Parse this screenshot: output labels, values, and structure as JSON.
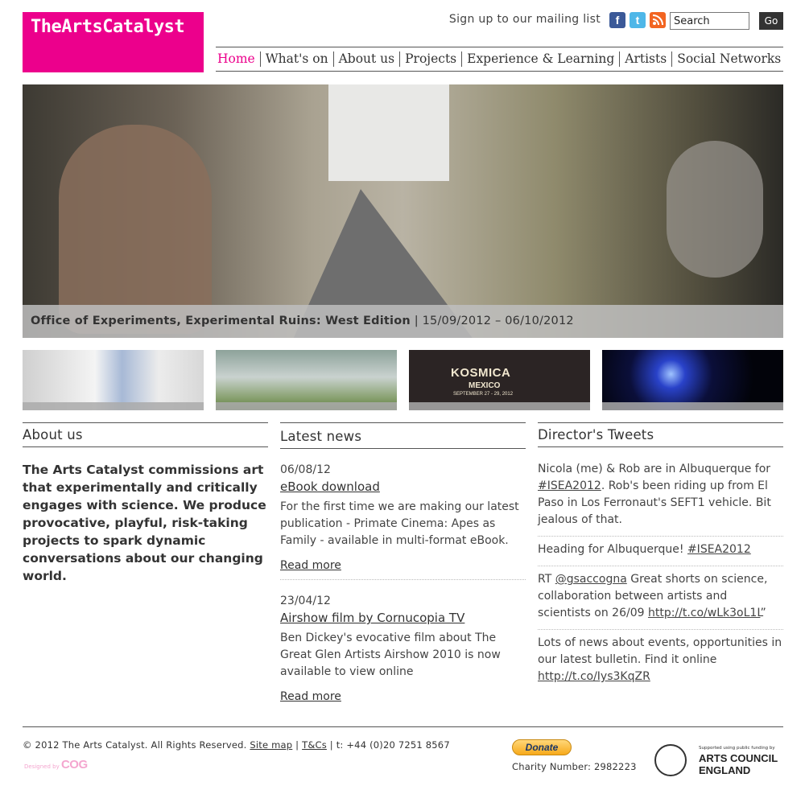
{
  "brand": {
    "logo_text": "TheArtsCatalyst",
    "accent_color": "#ec008c"
  },
  "header": {
    "signup_label": "Sign up to our mailing list",
    "social": {
      "facebook": "f",
      "twitter": "t",
      "rss": "rss"
    },
    "search": {
      "placeholder": "Search",
      "value": "Search",
      "go_label": "Go"
    }
  },
  "nav": {
    "items": [
      "Home",
      "What's on",
      "About us",
      "Projects",
      "Experience & Learning",
      "Artists",
      "Social Networks"
    ],
    "active": "Home"
  },
  "hero": {
    "title": "Office of Experiments, Experimental Ruins: West Edition",
    "dates": " | 15/09/2012 – 06/10/2012"
  },
  "thumbs": {
    "kosmica": {
      "title": "KOSMICA",
      "sub": "MEXICO",
      "dates": "SEPTEMBER 27 - 29, 2012"
    }
  },
  "about": {
    "heading": "About us",
    "text": "The Arts Catalyst commissions art that experimentally and critically engages with science. We produce provocative, playful, risk-taking projects to spark dynamic conversations about our changing world."
  },
  "news": {
    "heading": "Latest news",
    "items": [
      {
        "date": "06/08/12",
        "title": "eBook download",
        "excerpt": "For the first time we are making our latest publication - Primate Cinema: Apes as Family - available in multi-format eBook.",
        "more": "Read more"
      },
      {
        "date": "23/04/12",
        "title": "Airshow film by Cornucopia TV",
        "excerpt": "Ben Dickey's evocative film about The Great Glen Artists Airshow 2010 is now available to view online",
        "more": "Read more"
      }
    ]
  },
  "tweets": {
    "heading": "Director's Tweets",
    "items": [
      {
        "a": "Nicola (me) & Rob are in Albuquerque for ",
        "link": "#ISEA2012",
        "b": ". Rob's been riding up from El Paso in Los Ferronaut's SEFT1 vehicle. Bit jealous of that."
      },
      {
        "a": "Heading for Albuquerque! ",
        "link": "#ISEA2012",
        "b": ""
      },
      {
        "a": "RT ",
        "link": "@gsaccogna",
        "b": " Great shorts on science, collaboration between artists and scientists on 26/09 ",
        "link2": "http://t.co/wLk3oL1L",
        "c": "”"
      },
      {
        "a": "Lots of news about events, opportunities in our latest bulletin. Find it online ",
        "link": "http://t.co/Iys3KqZR",
        "b": ""
      }
    ]
  },
  "footer": {
    "copyright": "© 2012 The Arts Catalyst. All Rights Reserved. ",
    "sitemap": "Site map",
    "sep": " | ",
    "tcs": "T&Cs",
    "phone": " | t: +44 (0)20 7251 8567",
    "designed_by": "Designed by",
    "cog": "COG",
    "donate": "Donate",
    "charity": "Charity Number: 2982223",
    "ace_supported": "Supported using public funding by",
    "ace_name_1": "ARTS COUNCIL",
    "ace_name_2": "ENGLAND"
  }
}
